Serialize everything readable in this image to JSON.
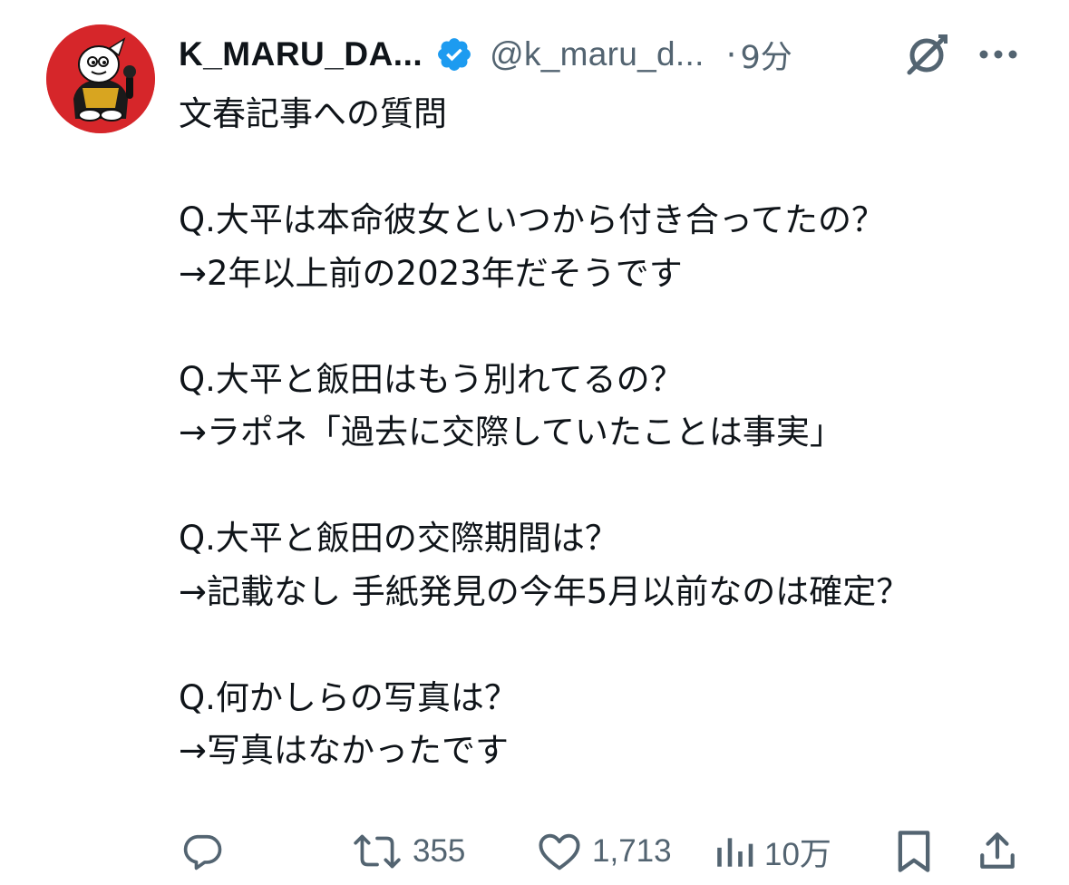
{
  "post": {
    "author": {
      "display_name": "K_MARU_DA...",
      "handle": "@k_maru_d...",
      "verified": true,
      "avatar_icon": "mascot-avatar-icon"
    },
    "separator": "·",
    "time": "9分",
    "body": "文春記事への質問\n\nQ.大平は本命彼女といつから付き合ってたの？\n→2年以上前の2023年だそうです\n\nQ.大平と飯田はもう別れてるの？\n→ラポネ「過去に交際していたことは事実」\n\nQ.大平と飯田の交際期間は？\n→記載なし 手紙発見の今年5月以前なのは確定？\n\nQ.何かしらの写真は？\n→写真はなかったです",
    "actions": {
      "reply": {
        "icon": "reply-icon",
        "count": ""
      },
      "repost": {
        "icon": "repost-icon",
        "count": "355"
      },
      "like": {
        "icon": "heart-icon",
        "count": "1,713"
      },
      "views": {
        "icon": "views-icon",
        "count": "10万"
      },
      "bookmark": {
        "icon": "bookmark-icon"
      },
      "share": {
        "icon": "share-icon"
      }
    }
  },
  "colors": {
    "text_primary": "#0f1419",
    "text_secondary": "#536471",
    "verified_blue": "#1d9bf0",
    "avatar_red": "#d6262a"
  }
}
